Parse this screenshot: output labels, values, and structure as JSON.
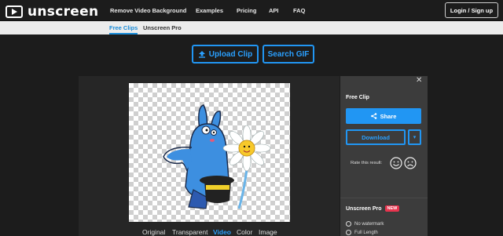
{
  "brand": {
    "name": "unscreen"
  },
  "nav": {
    "items": [
      "Remove Video Background",
      "Examples",
      "Pricing",
      "API",
      "FAQ"
    ],
    "login_label": "Login / Sign up"
  },
  "subnav": {
    "tabs": [
      "Free Clips",
      "Unscreen Pro"
    ],
    "active": "Free Clips"
  },
  "actions": {
    "upload_label": "Upload Clip",
    "search_label": "Search GIF"
  },
  "preview": {
    "view_tabs": [
      "Original",
      "Transparent",
      "Video",
      "Color",
      "Image"
    ],
    "active_view": "Video"
  },
  "panel": {
    "title": "Free Clip",
    "share_label": "Share",
    "download_label": "Download",
    "rate_label": "Rate this result:",
    "pro_title": "Unscreen Pro",
    "pro_badge": "NEW",
    "pro_features": [
      "No watermark",
      "Full Length"
    ]
  },
  "colors": {
    "accent": "#2196f3",
    "badge": "#e8344e",
    "background": "#1c1c1c"
  }
}
